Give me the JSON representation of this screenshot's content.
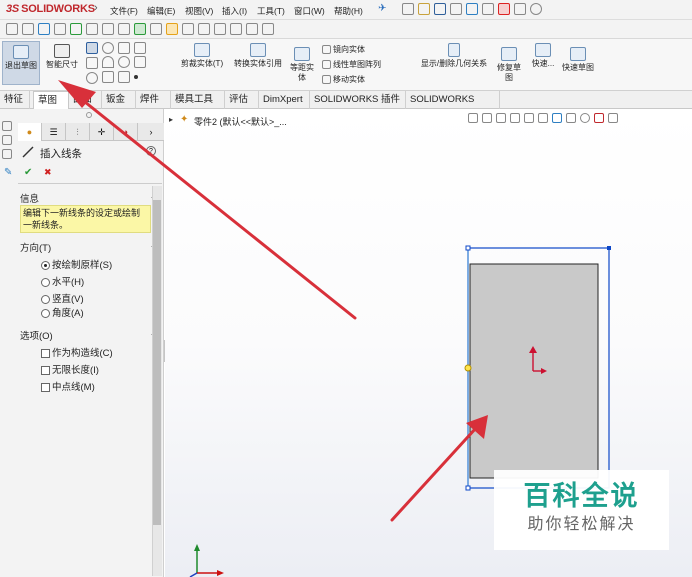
{
  "app": {
    "name": "SOLIDWORKS",
    "logo_prefix": "3S"
  },
  "menu": [
    "文件(F)",
    "编辑(E)",
    "视图(V)",
    "插入(I)",
    "工具(T)",
    "窗口(W)",
    "帮助(H)"
  ],
  "command_manager": {
    "exit_sketch": "退出草图",
    "smart_dimension": "智能尺寸",
    "trim": "剪裁实体(T)",
    "convert": "转换实体引用",
    "offset": "等距实体",
    "mirror": "镜向实体",
    "linear_pattern": "线性草图阵列",
    "move": "移动实体",
    "display_relations": "显示/删除几何关系",
    "repair": "修复草图",
    "quick_snaps": "快速...",
    "rapid_sketch": "快速草图"
  },
  "tabs": [
    "特征",
    "草图",
    "曲面",
    "钣金",
    "焊件",
    "模具工具",
    "评估",
    "DimXpert",
    "SOLIDWORKS 插件",
    "SOLIDWORKS MBD"
  ],
  "active_tab": 1,
  "panel": {
    "title": "插入线条",
    "help": "?",
    "ok": "✔",
    "cancel": "✖",
    "info_header": "信息",
    "info_text": "编辑下一新线条的设定或绘制一新线条。",
    "direction_header": "方向(T)",
    "direction_options": [
      "按绘制原样(S)",
      "水平(H)",
      "竖直(V)",
      "角度(A)"
    ],
    "direction_selected": 0,
    "options_header": "选项(O)",
    "options": [
      "作为构造线(C)",
      "无限长度(I)",
      "中点线(M)"
    ]
  },
  "tree": {
    "label": "零件2 (默认<<默认>_..."
  },
  "watermark": {
    "line1": "百科全说",
    "line2": "助你轻松解决"
  },
  "colors": {
    "accent": "#0d47c8",
    "annotation": "#d8303a",
    "axis_x": "#cc1111",
    "axis_y": "#1f8a2d",
    "info_bg": "#fbf7a6"
  }
}
